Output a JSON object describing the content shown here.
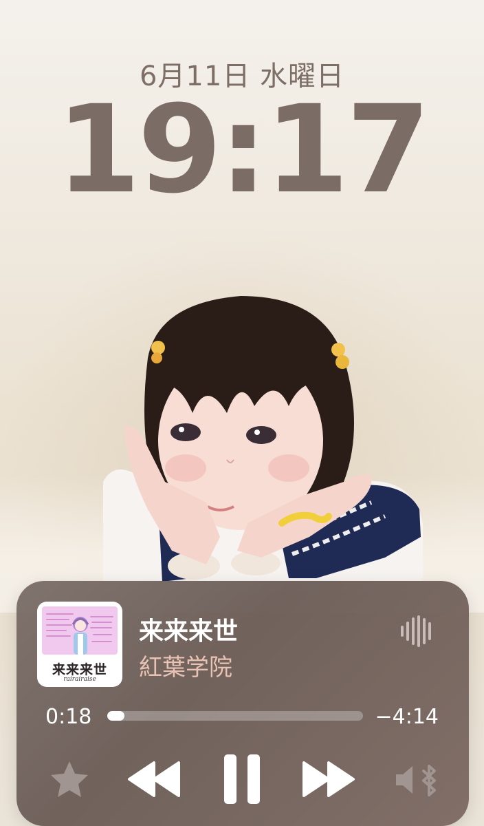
{
  "lockscreen": {
    "date": "6月11日 水曜日",
    "time": "19:17"
  },
  "now_playing": {
    "artwork": {
      "title": "来来来世",
      "subtitle": "rairairaise"
    },
    "song_title": "来来来世",
    "artist": "紅葉学院",
    "elapsed": "0:18",
    "remaining": "−4:14",
    "progress_fraction": 0.068,
    "controls": {
      "favorite": "star-icon",
      "previous": "rewind-icon",
      "play_pause": "pause-icon",
      "next": "fast-forward-icon",
      "output": "speaker-muted-bluetooth-icon",
      "airplay": "audio-waveform-icon"
    },
    "colors": {
      "artist_text": "#e8c2b3",
      "clock_text": "#7b6d65",
      "artwork_bg": "#f2c9ee"
    }
  }
}
